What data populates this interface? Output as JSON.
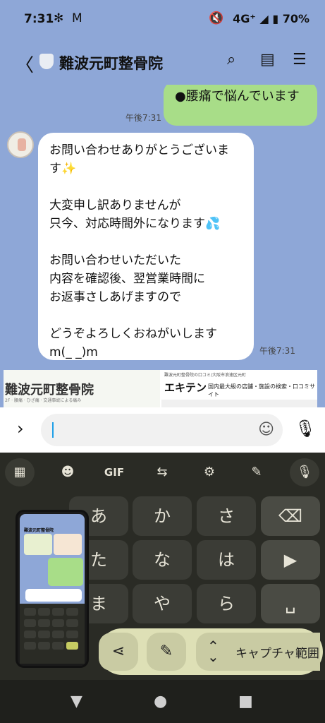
{
  "status_bar": {
    "time": "7:31",
    "network": "4G⁺",
    "battery": "70%"
  },
  "header": {
    "title": "難波元町整骨院"
  },
  "messages": {
    "sent": {
      "text": "●腰痛で悩んでいます",
      "time": "午後7:31"
    },
    "received": {
      "para1_line1": "お問い合わせありがとうございま",
      "para1_line2": "す",
      "para2_line1": "大変申し訳ありませんが",
      "para2_line2": "只今、対応時間外になります",
      "para3_line1": "お問い合わせいただいた",
      "para3_line2": "内容を確認後、翌営業時間に",
      "para3_line3": "お返事さしあげますので",
      "para4_line1": "どうぞよろしくおねがいします",
      "para4_line2": "m(_ _)m",
      "time": "午後7:31"
    }
  },
  "banner": {
    "left_title": "難波元町整骨院",
    "left_sub": "2F · 腰痛 · ひざ痛 · 交通事故による痛み",
    "right_top": "難波元町整骨院の口コミ/大阪市浪速区元町",
    "right_logo": "エキテン",
    "right_desc": "国内最大級の店舗・施設の検索・口コミサイト"
  },
  "input": {
    "placeholder": ""
  },
  "keyboard": {
    "toolbar": [
      "grid-icon",
      "sticker-icon",
      "GIF",
      "translate-icon",
      "gear-icon",
      "pen-icon",
      "mic-icon"
    ],
    "gif_label": "GIF",
    "rows": [
      [
        "あ",
        "か",
        "さ"
      ],
      [
        "た",
        "な",
        "は"
      ],
      [
        "ま",
        "や",
        "ら"
      ]
    ]
  },
  "capture": {
    "range_label": "キャプチャ範囲"
  },
  "thumbnail": {
    "title": "難波元町整骨院"
  }
}
